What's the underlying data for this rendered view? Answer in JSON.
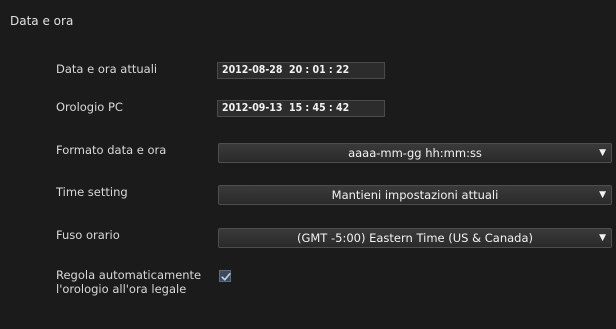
{
  "section": {
    "title": "Data e ora"
  },
  "fields": {
    "current_datetime": {
      "label": "Data e ora attuali",
      "value": "2012-08-28  20 : 01 : 22"
    },
    "pc_clock": {
      "label": "Orologio PC",
      "value": "2012-09-13  15 : 45 : 42"
    },
    "datetime_format": {
      "label": "Formato data e ora",
      "selected": "aaaa-mm-gg hh:mm:ss"
    },
    "time_setting": {
      "label": "Time setting",
      "selected": "Mantieni impostazioni attuali"
    },
    "timezone": {
      "label": "Fuso orario",
      "selected": "(GMT -5:00) Eastern Time (US & Canada)"
    },
    "dst": {
      "label_line1": "Regola automaticamente",
      "label_line2": "l'orologio all'ora legale",
      "checked": true
    }
  },
  "icons": {
    "dropdown": "chevron-down-icon",
    "check": "checkmark-icon"
  },
  "colors": {
    "background": "#1b1b1b",
    "field_bg": "#2c2c2c",
    "text": "#dcdcdc",
    "checkbox_accent": "#3c4a5e"
  }
}
